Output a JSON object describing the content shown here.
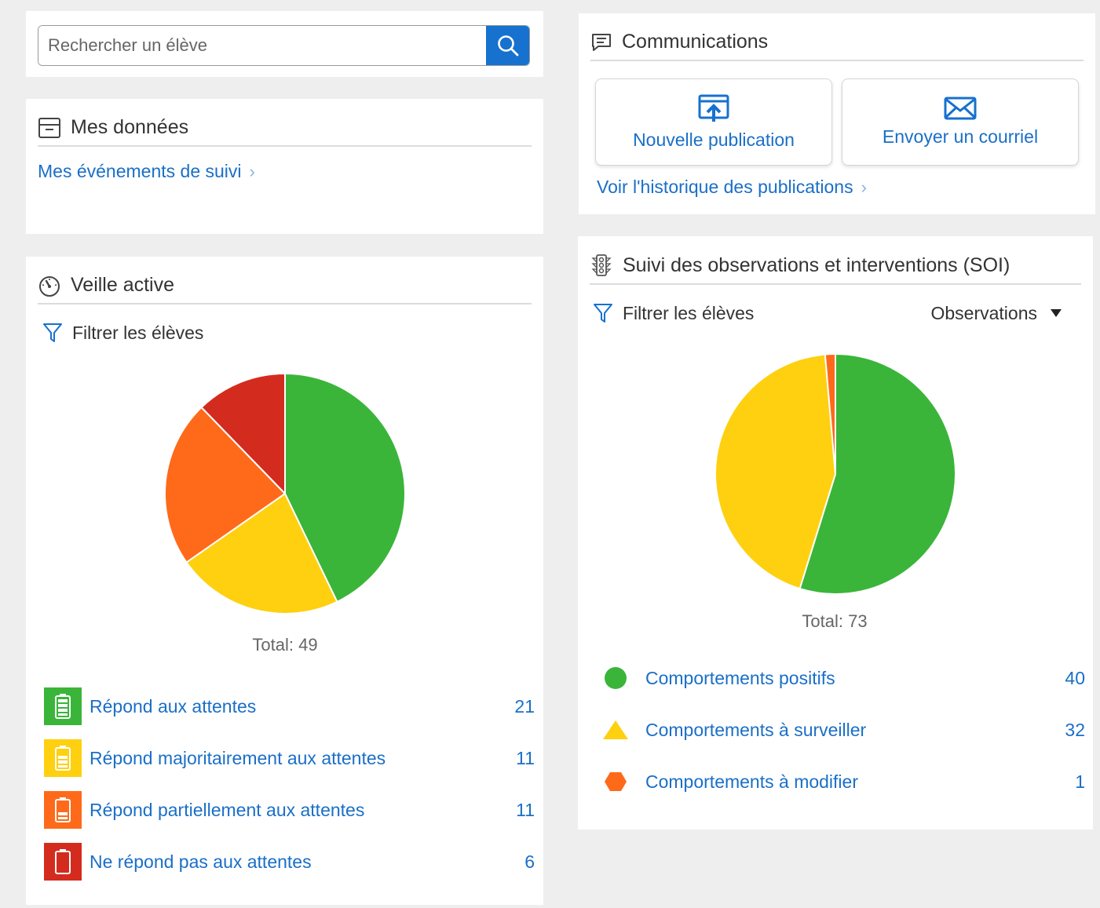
{
  "search": {
    "placeholder": "Rechercher un élève"
  },
  "mes_donnees": {
    "title": "Mes données",
    "link": "Mes événements de suivi"
  },
  "communications": {
    "title": "Communications",
    "new_publication": "Nouvelle publication",
    "send_email": "Envoyer un courriel",
    "history_link": "Voir l'historique des publications"
  },
  "veille": {
    "title": "Veille active",
    "filter": "Filtrer les élèves",
    "total_label": "Total: 49",
    "legend": [
      {
        "label": "Répond aux attentes",
        "count": "21",
        "color": "#3ab53a"
      },
      {
        "label": "Répond majoritairement aux attentes",
        "count": "11",
        "color": "#fed010"
      },
      {
        "label": "Répond partiellement aux attentes",
        "count": "11",
        "color": "#fe6a1a"
      },
      {
        "label": "Ne répond pas aux attentes",
        "count": "6",
        "color": "#d42b1f"
      }
    ]
  },
  "soi": {
    "title": "Suivi des observations et interventions (SOI)",
    "filter": "Filtrer les élèves",
    "dropdown": "Observations",
    "total_label": "Total: 73",
    "legend": [
      {
        "label": "Comportements positifs",
        "count": "40",
        "color": "#3ab53a",
        "shape": "circle"
      },
      {
        "label": "Comportements à surveiller",
        "count": "32",
        "color": "#fed010",
        "shape": "triangle"
      },
      {
        "label": "Comportements à modifier",
        "count": "1",
        "color": "#fe6a1a",
        "shape": "hexagon"
      }
    ]
  },
  "colors": {
    "accent": "#1671cf",
    "link": "#1a6fc7"
  },
  "chart_data": [
    {
      "type": "pie",
      "categories": [
        "Répond aux attentes",
        "Répond majoritairement aux attentes",
        "Répond partiellement aux attentes",
        "Ne répond pas aux attentes"
      ],
      "values": [
        21,
        11,
        11,
        6
      ],
      "colors": [
        "#3ab53a",
        "#fed010",
        "#fe6a1a",
        "#d42b1f"
      ],
      "title": "Total: 49"
    },
    {
      "type": "pie",
      "categories": [
        "Comportements positifs",
        "Comportements à surveiller",
        "Comportements à modifier"
      ],
      "values": [
        40,
        32,
        1
      ],
      "colors": [
        "#3ab53a",
        "#fed010",
        "#fe6a1a"
      ],
      "title": "Total: 73"
    }
  ]
}
